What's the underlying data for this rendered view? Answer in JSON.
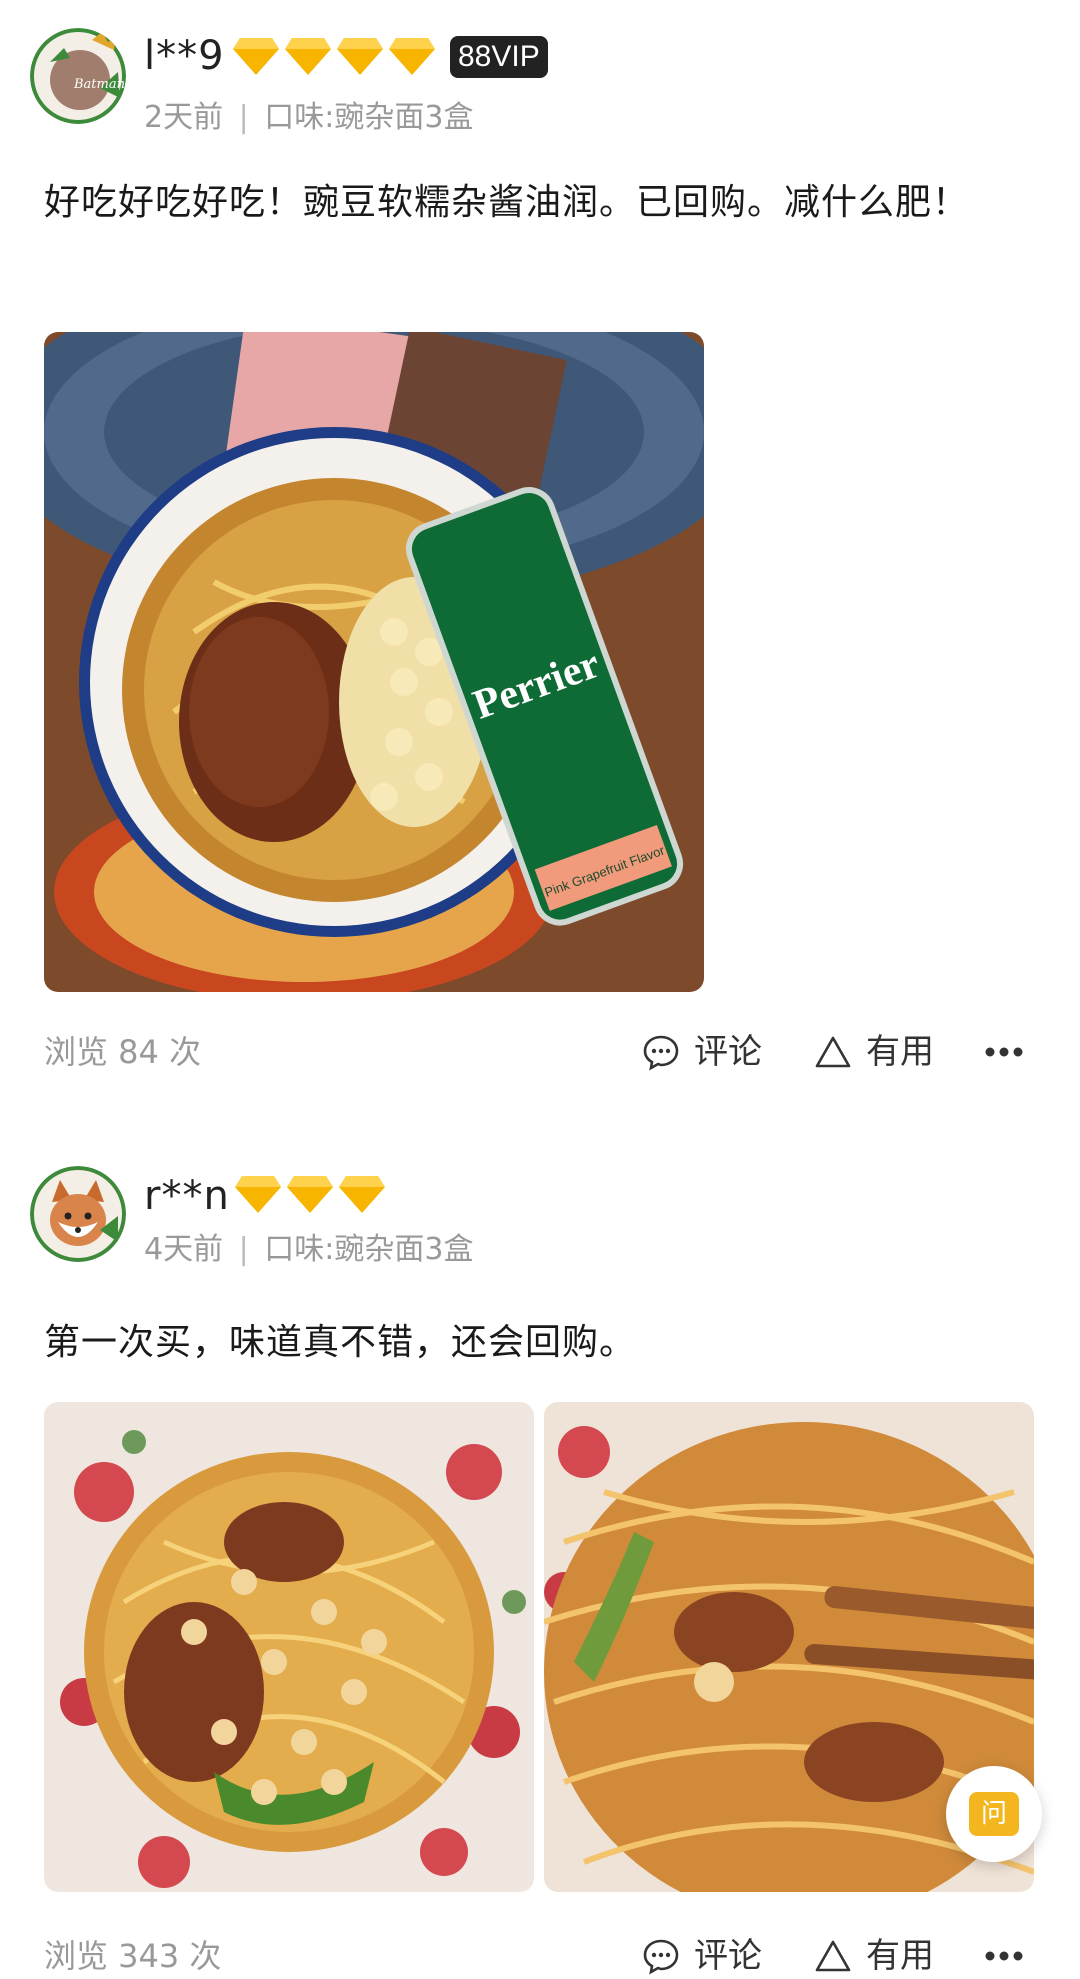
{
  "reviews": [
    {
      "username": "l**9",
      "vip_label": "88VIP",
      "diamond_count": 4,
      "avatar_icon": "batman-avatar-icon",
      "time": "2天前",
      "separator": "|",
      "flavor": "口味:豌杂面3盒",
      "text": "好吃好吃好吃！豌豆软糯杂酱油润。已回购。减什么肥！",
      "views": "浏览 84 次",
      "comment_label": "评论",
      "useful_label": "有用"
    },
    {
      "username": "r**n",
      "diamond_count": 3,
      "avatar_icon": "fox-avatar-icon",
      "time": "4天前",
      "separator": "|",
      "flavor": "口味:豌杂面3盒",
      "text": "第一次买，味道真不错，还会回购。",
      "views": "浏览 343 次",
      "comment_label": "评论",
      "useful_label": "有用"
    }
  ],
  "photo1": {
    "can_text": "Perrier",
    "can_flavor": "Pink Grapefruit Flavor"
  },
  "ask_button_label": "问",
  "colors": {
    "diamond": "#f7b500",
    "meta_gray": "#999999",
    "vip_bg": "#222222",
    "ask_accent": "#f3b61f"
  }
}
